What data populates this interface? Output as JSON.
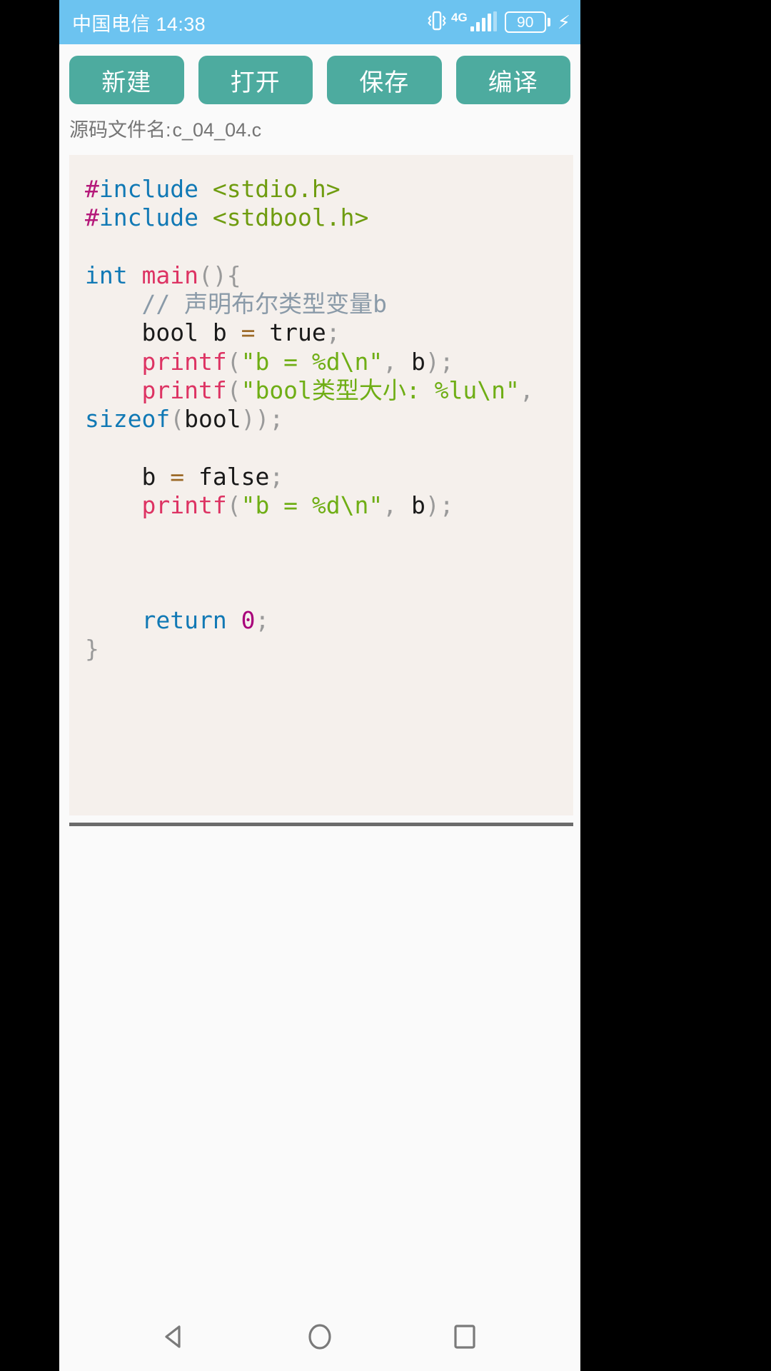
{
  "status_bar": {
    "carrier_and_time": "中国电信 14:38",
    "vibrate_icon": "vibrate-icon",
    "network_type": "4G",
    "signal_icon": "signal-bars-icon",
    "battery_level": "90",
    "charging_icon": "charging-bolt-icon",
    "background_color": "#6cc3f0"
  },
  "toolbar": {
    "accent_color": "#4dab9f",
    "buttons": [
      {
        "label": "新建",
        "name": "new-file-button"
      },
      {
        "label": "打开",
        "name": "open-file-button"
      },
      {
        "label": "保存",
        "name": "save-file-button"
      },
      {
        "label": "编译",
        "name": "compile-button"
      }
    ]
  },
  "file_info": {
    "label": "源码文件名:",
    "filename": "c_04_04.c"
  },
  "editor": {
    "background_color": "#f5f0ec",
    "lines": [
      {
        "tokens": [
          {
            "t": "#",
            "c": "t-pre"
          },
          {
            "t": "include",
            "c": "t-kw"
          },
          {
            "t": " ",
            "c": "t-id"
          },
          {
            "t": "<stdio.h>",
            "c": "t-inc"
          }
        ]
      },
      {
        "tokens": [
          {
            "t": "#",
            "c": "t-pre"
          },
          {
            "t": "include",
            "c": "t-kw"
          },
          {
            "t": " ",
            "c": "t-id"
          },
          {
            "t": "<stdbool.h>",
            "c": "t-inc"
          }
        ]
      },
      {
        "tokens": []
      },
      {
        "tokens": [
          {
            "t": "int",
            "c": "t-kw"
          },
          {
            "t": " ",
            "c": "t-id"
          },
          {
            "t": "main",
            "c": "t-fn"
          },
          {
            "t": "(){",
            "c": "t-punct"
          }
        ]
      },
      {
        "tokens": [
          {
            "t": "    ",
            "c": "t-id"
          },
          {
            "t": "// 声明布尔类型变量b",
            "c": "t-cmt"
          }
        ]
      },
      {
        "tokens": [
          {
            "t": "    ",
            "c": "t-id"
          },
          {
            "t": "bool b ",
            "c": "t-id"
          },
          {
            "t": "=",
            "c": "t-op"
          },
          {
            "t": " true",
            "c": "t-id"
          },
          {
            "t": ";",
            "c": "t-punct"
          }
        ]
      },
      {
        "tokens": [
          {
            "t": "    ",
            "c": "t-id"
          },
          {
            "t": "printf",
            "c": "t-fn"
          },
          {
            "t": "(",
            "c": "t-punct"
          },
          {
            "t": "\"b = %d\\n\"",
            "c": "t-str"
          },
          {
            "t": ",",
            "c": "t-punct"
          },
          {
            "t": " b",
            "c": "t-id"
          },
          {
            "t": ");",
            "c": "t-punct"
          }
        ]
      },
      {
        "tokens": [
          {
            "t": "    ",
            "c": "t-id"
          },
          {
            "t": "printf",
            "c": "t-fn"
          },
          {
            "t": "(",
            "c": "t-punct"
          },
          {
            "t": "\"bool类型大小: %lu\\n\"",
            "c": "t-str"
          },
          {
            "t": ",",
            "c": "t-punct"
          },
          {
            "t": " ",
            "c": "t-id"
          },
          {
            "t": "sizeof",
            "c": "t-kw"
          },
          {
            "t": "(",
            "c": "t-punct"
          },
          {
            "t": "bool",
            "c": "t-id"
          },
          {
            "t": "));",
            "c": "t-punct"
          }
        ]
      },
      {
        "tokens": []
      },
      {
        "tokens": [
          {
            "t": "    ",
            "c": "t-id"
          },
          {
            "t": "b ",
            "c": "t-id"
          },
          {
            "t": "=",
            "c": "t-op"
          },
          {
            "t": " false",
            "c": "t-id"
          },
          {
            "t": ";",
            "c": "t-punct"
          }
        ]
      },
      {
        "tokens": [
          {
            "t": "    ",
            "c": "t-id"
          },
          {
            "t": "printf",
            "c": "t-fn"
          },
          {
            "t": "(",
            "c": "t-punct"
          },
          {
            "t": "\"b = %d\\n\"",
            "c": "t-str"
          },
          {
            "t": ",",
            "c": "t-punct"
          },
          {
            "t": " b",
            "c": "t-id"
          },
          {
            "t": ");",
            "c": "t-punct"
          }
        ]
      },
      {
        "tokens": []
      },
      {
        "tokens": []
      },
      {
        "tokens": []
      },
      {
        "tokens": [
          {
            "t": "    ",
            "c": "t-id"
          },
          {
            "t": "return",
            "c": "t-kw"
          },
          {
            "t": " ",
            "c": "t-id"
          },
          {
            "t": "0",
            "c": "t-num"
          },
          {
            "t": ";",
            "c": "t-punct"
          }
        ]
      },
      {
        "tokens": [
          {
            "t": "}",
            "c": "t-punct"
          }
        ]
      }
    ]
  },
  "output": {
    "text": ""
  },
  "nav_bar": {
    "back": "back-triangle-icon",
    "home": "home-circle-icon",
    "recents": "recents-square-icon"
  }
}
